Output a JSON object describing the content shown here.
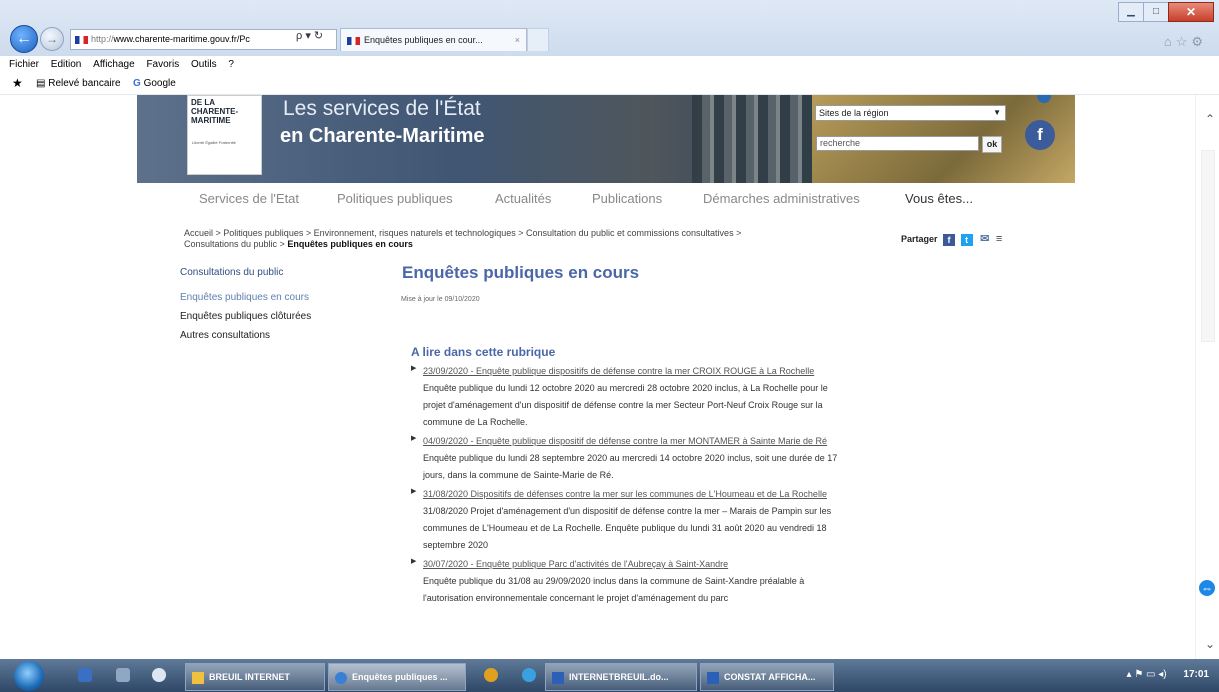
{
  "browser": {
    "address_proto": "http://",
    "address_host": "www.charente-maritime.gouv.fr/Pc",
    "address_controls": "ρ ▾ ↻",
    "tab_label": "Enquêtes publiques en cour...",
    "tab_close": "×"
  },
  "menu": [
    "Fichier",
    "Edition",
    "Affichage",
    "Favoris",
    "Outils",
    "?"
  ],
  "favorites": {
    "item1": "Relevé bancaire",
    "item2": "Google"
  },
  "banner": {
    "logo_text": "DE LA CHARENTE-MARITIME",
    "logo_motto": "Liberté Égalité Fraternité",
    "brand_line1": "Les services de l'État",
    "brand_line2": "en Charente-Maritime",
    "region_select": "Sites de la région",
    "search_placeholder": "recherche",
    "ok_label": "ok",
    "facebook_label": "f"
  },
  "nav": [
    "Services de l'Etat",
    "Politiques publiques",
    "Actualités",
    "Publications",
    "Démarches administratives",
    "Vous êtes..."
  ],
  "breadcrumb": {
    "line1": "Accueil > Politiques publiques > Environnement, risques naturels et technologiques > Consultation du public et commissions consultatives >",
    "line2_prefix": "Consultations du public > ",
    "line2_current": "Enquêtes publiques en cours"
  },
  "share": {
    "label": "Partager",
    "facebook": "f",
    "twitter": "t",
    "mail": "✉",
    "print": "≡"
  },
  "sidebar": {
    "title": "Consultations du public",
    "items": [
      "Enquêtes publiques en cours",
      "Enquêtes publiques clôturées",
      "Autres consultations"
    ]
  },
  "main": {
    "title": "Enquêtes publiques en cours",
    "updated": "Mise à jour le 09/10/2020",
    "section_title": "A lire dans cette rubrique",
    "items": [
      {
        "link": "23/09/2020 - Enquête publique dispositifs de défense contre la mer CROIX ROUGE à La Rochelle",
        "desc": "Enquête publique du lundi 12 octobre 2020 au mercredi 28 octobre 2020 inclus, à La Rochelle pour le projet d'aménagement d'un dispositif de défense contre la mer Secteur Port-Neuf Croix Rouge sur la commune de La Rochelle."
      },
      {
        "link": "04/09/2020 - Enquête publique dispositif de défense contre la mer MONTAMER à Sainte Marie de Ré",
        "desc": "Enquête publique du lundi 28 septembre 2020 au mercredi 14 octobre 2020 inclus, soit une durée de 17 jours, dans la commune de Sainte-Marie de Ré."
      },
      {
        "link": "31/08/2020 Dispositifs de défenses contre la mer sur les communes de L'Houmeau et de La Rochelle",
        "desc": "31/08/2020 Projet d'aménagement d'un dispositif de défense contre la mer – Marais de Pampin sur les communes de L'Houmeau et de La Rochelle. Enquête publique du lundi 31 août 2020 au vendredi 18 septembre 2020"
      },
      {
        "link": "30/07/2020 - Enquête publique Parc d'activités de l'Aubreçay à Saint-Xandre",
        "desc": "Enquête publique du 31/08 au 29/09/2020 inclus dans la commune de Saint-Xandre préalable à l'autorisation environnementale concernant le projet d'aménagement du parc"
      }
    ]
  },
  "taskbar": {
    "tasks": [
      "BREUIL INTERNET",
      "Enquêtes publiques ...",
      "INTERNETBREUIL.do...",
      "CONSTAT AFFICHA..."
    ],
    "clock": "17:01"
  },
  "colors": {
    "accent_blue": "#4a67a8",
    "sidebar_active": "#5f7fb0",
    "facebook": "#3b5998"
  }
}
